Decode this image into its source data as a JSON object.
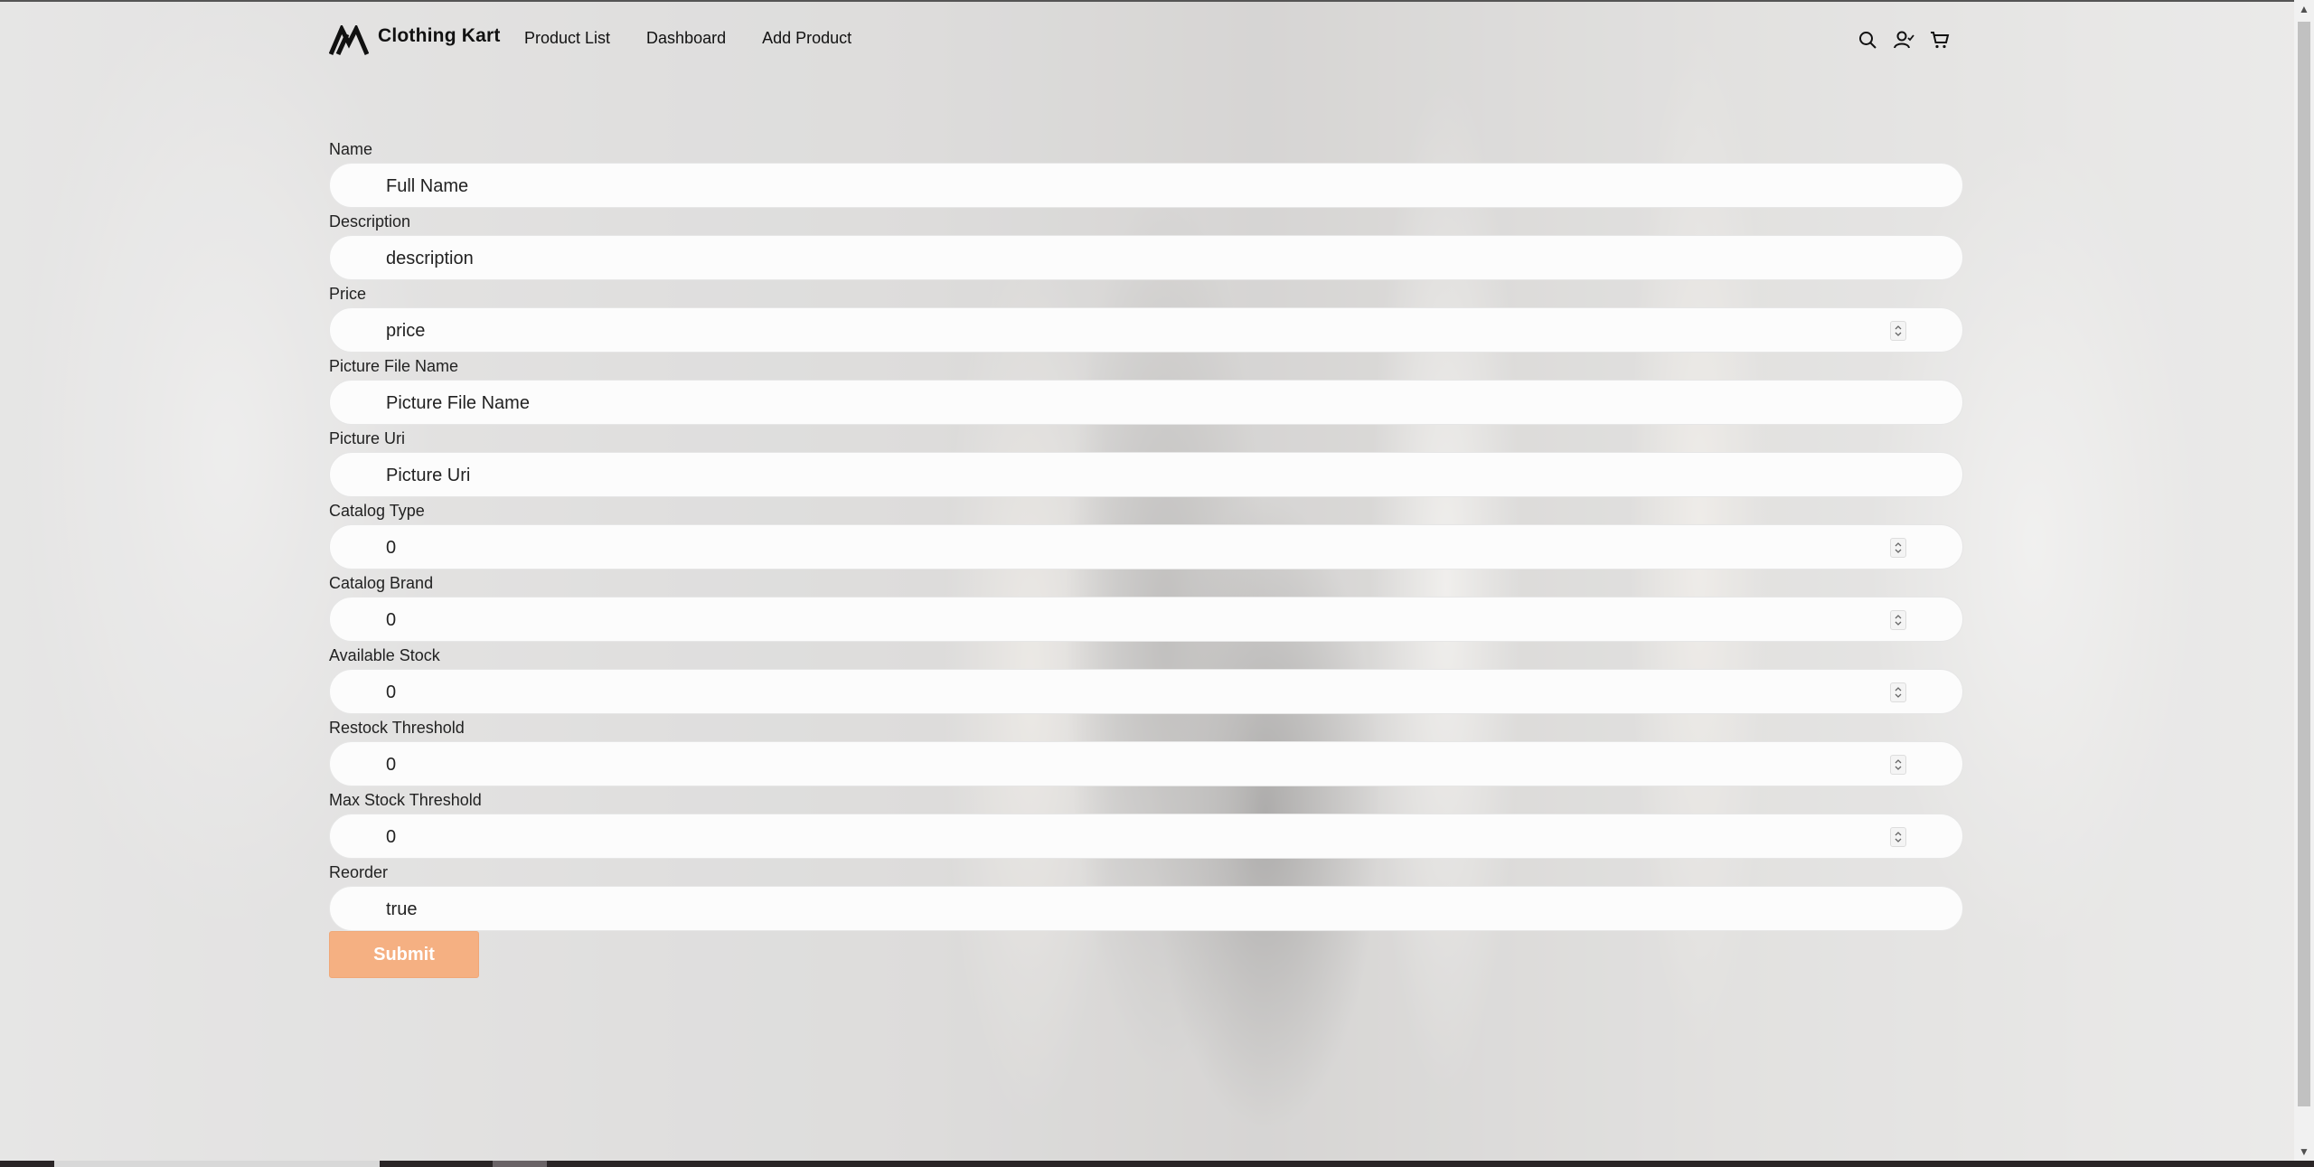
{
  "brand": {
    "name": "Clothing Kart"
  },
  "nav": [
    "Product List",
    "Dashboard",
    "Add Product"
  ],
  "header_icons": [
    "search-icon",
    "user-icon",
    "cart-icon"
  ],
  "form": {
    "fields": [
      {
        "label": "Name",
        "type": "text",
        "placeholder": "Full Name",
        "value": ""
      },
      {
        "label": "Description",
        "type": "text",
        "placeholder": "description",
        "value": ""
      },
      {
        "label": "Price",
        "type": "number",
        "placeholder": "price",
        "value": ""
      },
      {
        "label": "Picture File Name",
        "type": "text",
        "placeholder": "Picture File Name",
        "value": ""
      },
      {
        "label": "Picture Uri",
        "type": "text",
        "placeholder": "Picture Uri",
        "value": ""
      },
      {
        "label": "Catalog Type",
        "type": "number",
        "placeholder": "",
        "value": "0"
      },
      {
        "label": "Catalog Brand",
        "type": "number",
        "placeholder": "",
        "value": "0"
      },
      {
        "label": "Available Stock",
        "type": "number",
        "placeholder": "",
        "value": "0"
      },
      {
        "label": "Restock Threshold",
        "type": "number",
        "placeholder": "",
        "value": "0"
      },
      {
        "label": "Max Stock Threshold",
        "type": "number",
        "placeholder": "",
        "value": "0"
      },
      {
        "label": "Reorder",
        "type": "text",
        "placeholder": "",
        "value": "true"
      }
    ],
    "submit_label": "Submit"
  },
  "colors": {
    "accent": "#f5b082",
    "text": "#111111"
  }
}
